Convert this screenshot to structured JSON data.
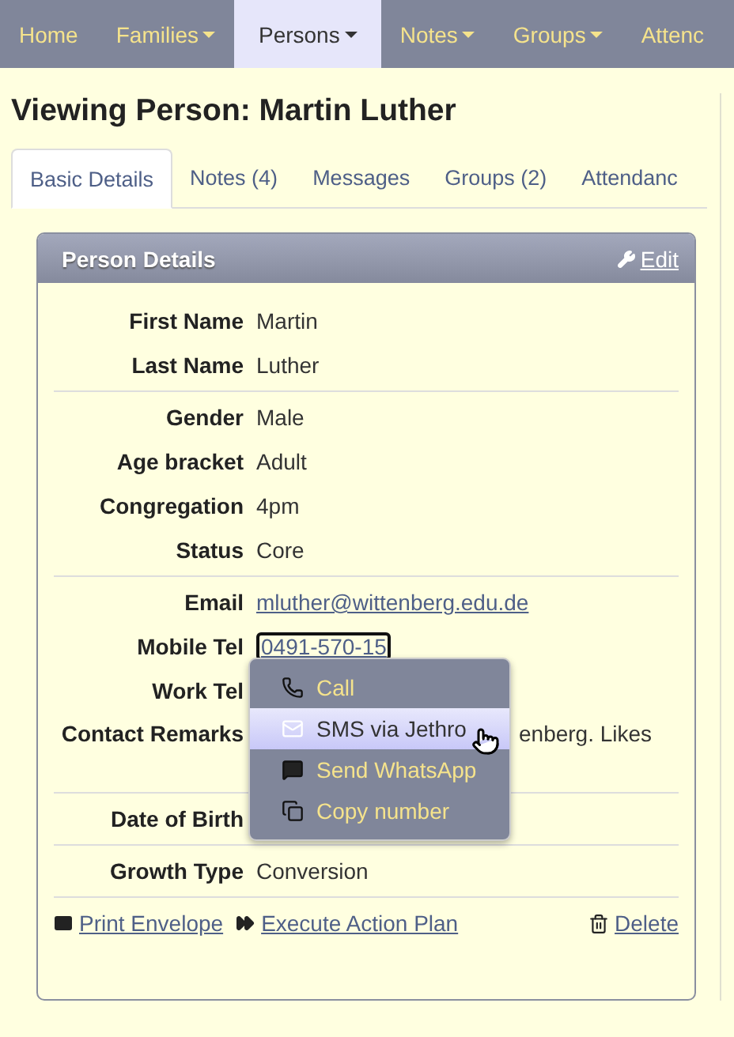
{
  "nav": [
    {
      "label": "Home",
      "dropdown": false,
      "selected": false
    },
    {
      "label": "Families",
      "dropdown": true,
      "selected": false
    },
    {
      "label": "Persons",
      "dropdown": true,
      "selected": true
    },
    {
      "label": "Notes",
      "dropdown": true,
      "selected": false
    },
    {
      "label": "Groups",
      "dropdown": true,
      "selected": false
    },
    {
      "label": "Attenc",
      "dropdown": false,
      "selected": false
    }
  ],
  "heading": "Viewing Person: Martin Luther",
  "tabs": [
    {
      "label": "Basic Details",
      "selected": true
    },
    {
      "label": "Notes (4)",
      "selected": false
    },
    {
      "label": "Messages",
      "selected": false
    },
    {
      "label": "Groups (2)",
      "selected": false
    },
    {
      "label": "Attendanc",
      "selected": false
    }
  ],
  "panel": {
    "title": "Person Details",
    "edit": "Edit",
    "sections": [
      [
        {
          "label": "First Name",
          "value": "Martin",
          "kind": "text"
        },
        {
          "label": "Last Name",
          "value": "Luther",
          "kind": "text"
        }
      ],
      [
        {
          "label": "Gender",
          "value": "Male",
          "kind": "text"
        },
        {
          "label": "Age bracket",
          "value": "Adult",
          "kind": "text"
        },
        {
          "label": "Congregation",
          "value": "4pm",
          "kind": "text"
        },
        {
          "label": "Status",
          "value": "Core",
          "kind": "text"
        }
      ],
      [
        {
          "label": "Email",
          "value": "mluther@wittenberg.edu.de",
          "kind": "link"
        },
        {
          "label": "Mobile Tel",
          "value": "0491-570-15",
          "kind": "phone"
        },
        {
          "label": "Work Tel",
          "kind": "hidden"
        },
        {
          "label": "Contact Remarks",
          "value": "enberg. Likes",
          "kind": "remark"
        }
      ],
      [
        {
          "label": "Date of Birth",
          "kind": "hidden"
        }
      ],
      [
        {
          "label": "Growth Type",
          "value": "Conversion",
          "kind": "text"
        }
      ]
    ],
    "actions": [
      "Print Envelope",
      "Execute Action Plan"
    ],
    "delete": "Delete"
  },
  "menu": [
    {
      "label": "Call",
      "selected": false
    },
    {
      "label": "SMS via Jethro",
      "selected": true
    },
    {
      "label": "Send WhatsApp",
      "selected": false
    },
    {
      "label": "Copy number",
      "selected": false
    }
  ]
}
